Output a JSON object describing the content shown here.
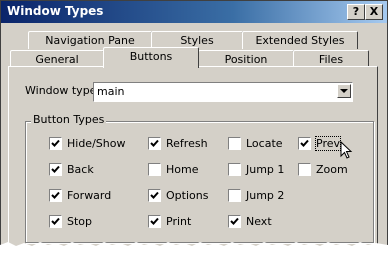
{
  "window": {
    "title": "Window Types",
    "help_glyph": "?",
    "close_glyph": "X"
  },
  "tabs": {
    "row1": [
      "Navigation Pane",
      "Styles",
      "Extended Styles"
    ],
    "row2": [
      "General",
      "Buttons",
      "Position",
      "Files"
    ],
    "active": "Buttons"
  },
  "window_type": {
    "label": "Window type:",
    "value": "main"
  },
  "group": {
    "title": "Button Types",
    "checkboxes": [
      {
        "label": "Hide/Show",
        "checked": true
      },
      {
        "label": "Back",
        "checked": true
      },
      {
        "label": "Forward",
        "checked": true
      },
      {
        "label": "Stop",
        "checked": true
      },
      {
        "label": "Refresh",
        "checked": true
      },
      {
        "label": "Home",
        "checked": false
      },
      {
        "label": "Options",
        "checked": true
      },
      {
        "label": "Print",
        "checked": true
      },
      {
        "label": "Locate",
        "checked": false
      },
      {
        "label": "Jump 1",
        "checked": false
      },
      {
        "label": "Jump 2",
        "checked": false
      },
      {
        "label": "Next",
        "checked": true
      },
      {
        "label": "Prev",
        "checked": true
      },
      {
        "label": "Zoom",
        "checked": false
      }
    ]
  }
}
